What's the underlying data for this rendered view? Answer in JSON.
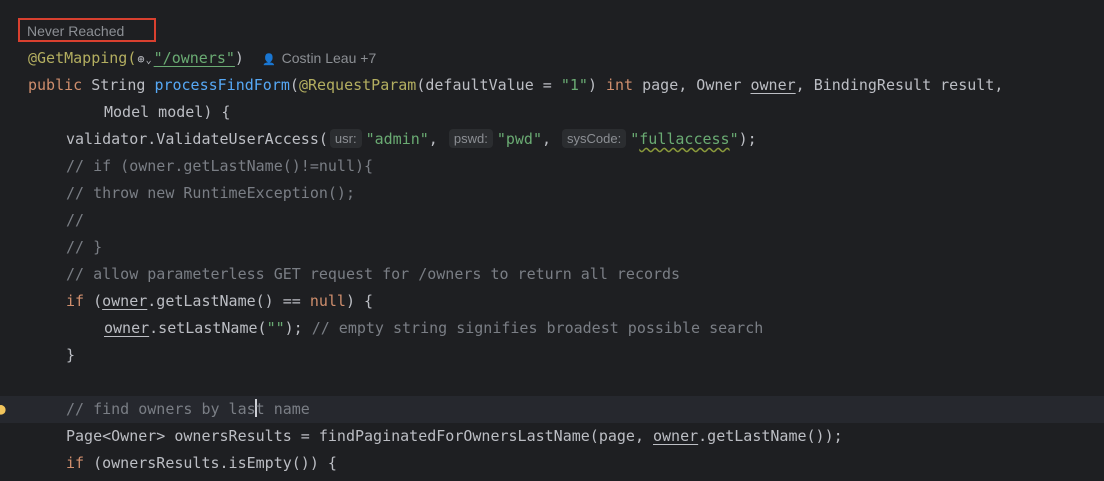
{
  "inlay": {
    "never_reached": "Never Reached",
    "author": "Costin Leau +7",
    "globe_icon": "globe-icon",
    "usr_hint": "usr:",
    "pswd_hint": "pswd:",
    "syscode_hint": "sysCode:"
  },
  "code": {
    "l1": {
      "ann": "@GetMapping(",
      "str": "\"/owners\"",
      "close": ")"
    },
    "l2": {
      "kw_public": "public",
      "type": " String ",
      "fn": "processFindForm",
      "p1": "(",
      "ann": "@RequestParam",
      "p2": "(defaultValue = ",
      "str": "\"1\"",
      "p3": ") ",
      "kw_int": "int",
      "p4": " page, Owner ",
      "owner": "owner",
      "p5": ", BindingResult result,"
    },
    "l3": {
      "text": "Model model) {"
    },
    "l4": {
      "a": "validator.ValidateUserAccess(",
      "s1": "\"admin\"",
      "comma1": ", ",
      "s2": "\"pwd\"",
      "comma2": ", ",
      "s3q1": "\"",
      "s3": "fullaccess",
      "s3q2": "\"",
      "end": ");"
    },
    "l5": "// if (owner.getLastName()!=null){",
    "l6": "// throw new RuntimeException();",
    "l7": "//",
    "l8": "// }",
    "l9": "// allow parameterless GET request for /owners to return all records",
    "l10": {
      "kw_if": "if",
      "a": " (",
      "owner": "owner",
      "b": ".getLastName() == ",
      "kw_null": "null",
      "c": ") {"
    },
    "l11": {
      "owner": "owner",
      "a": ".setLastName(",
      "str": "\"\"",
      "b": "); ",
      "cmt": "// empty string signifies broadest possible search"
    },
    "l12": "}",
    "l13": {
      "a": "// find owners by las",
      "b": "t name"
    },
    "l14": {
      "a": "Page<Owner> ownersResults = findPaginatedForOwnersLastName(page, ",
      "owner": "owner",
      "b": ".getLastName());"
    },
    "l15": {
      "kw_if": "if",
      "a": " (ownersResults.isEmpty()) {"
    }
  },
  "colors": {
    "background": "#1e1f22",
    "keyword": "#cf8e6d",
    "annotation": "#b3ae60",
    "function": "#56a8f5",
    "string": "#6aab73",
    "comment": "#7a7e85",
    "highlight_box": "#d9402f"
  }
}
